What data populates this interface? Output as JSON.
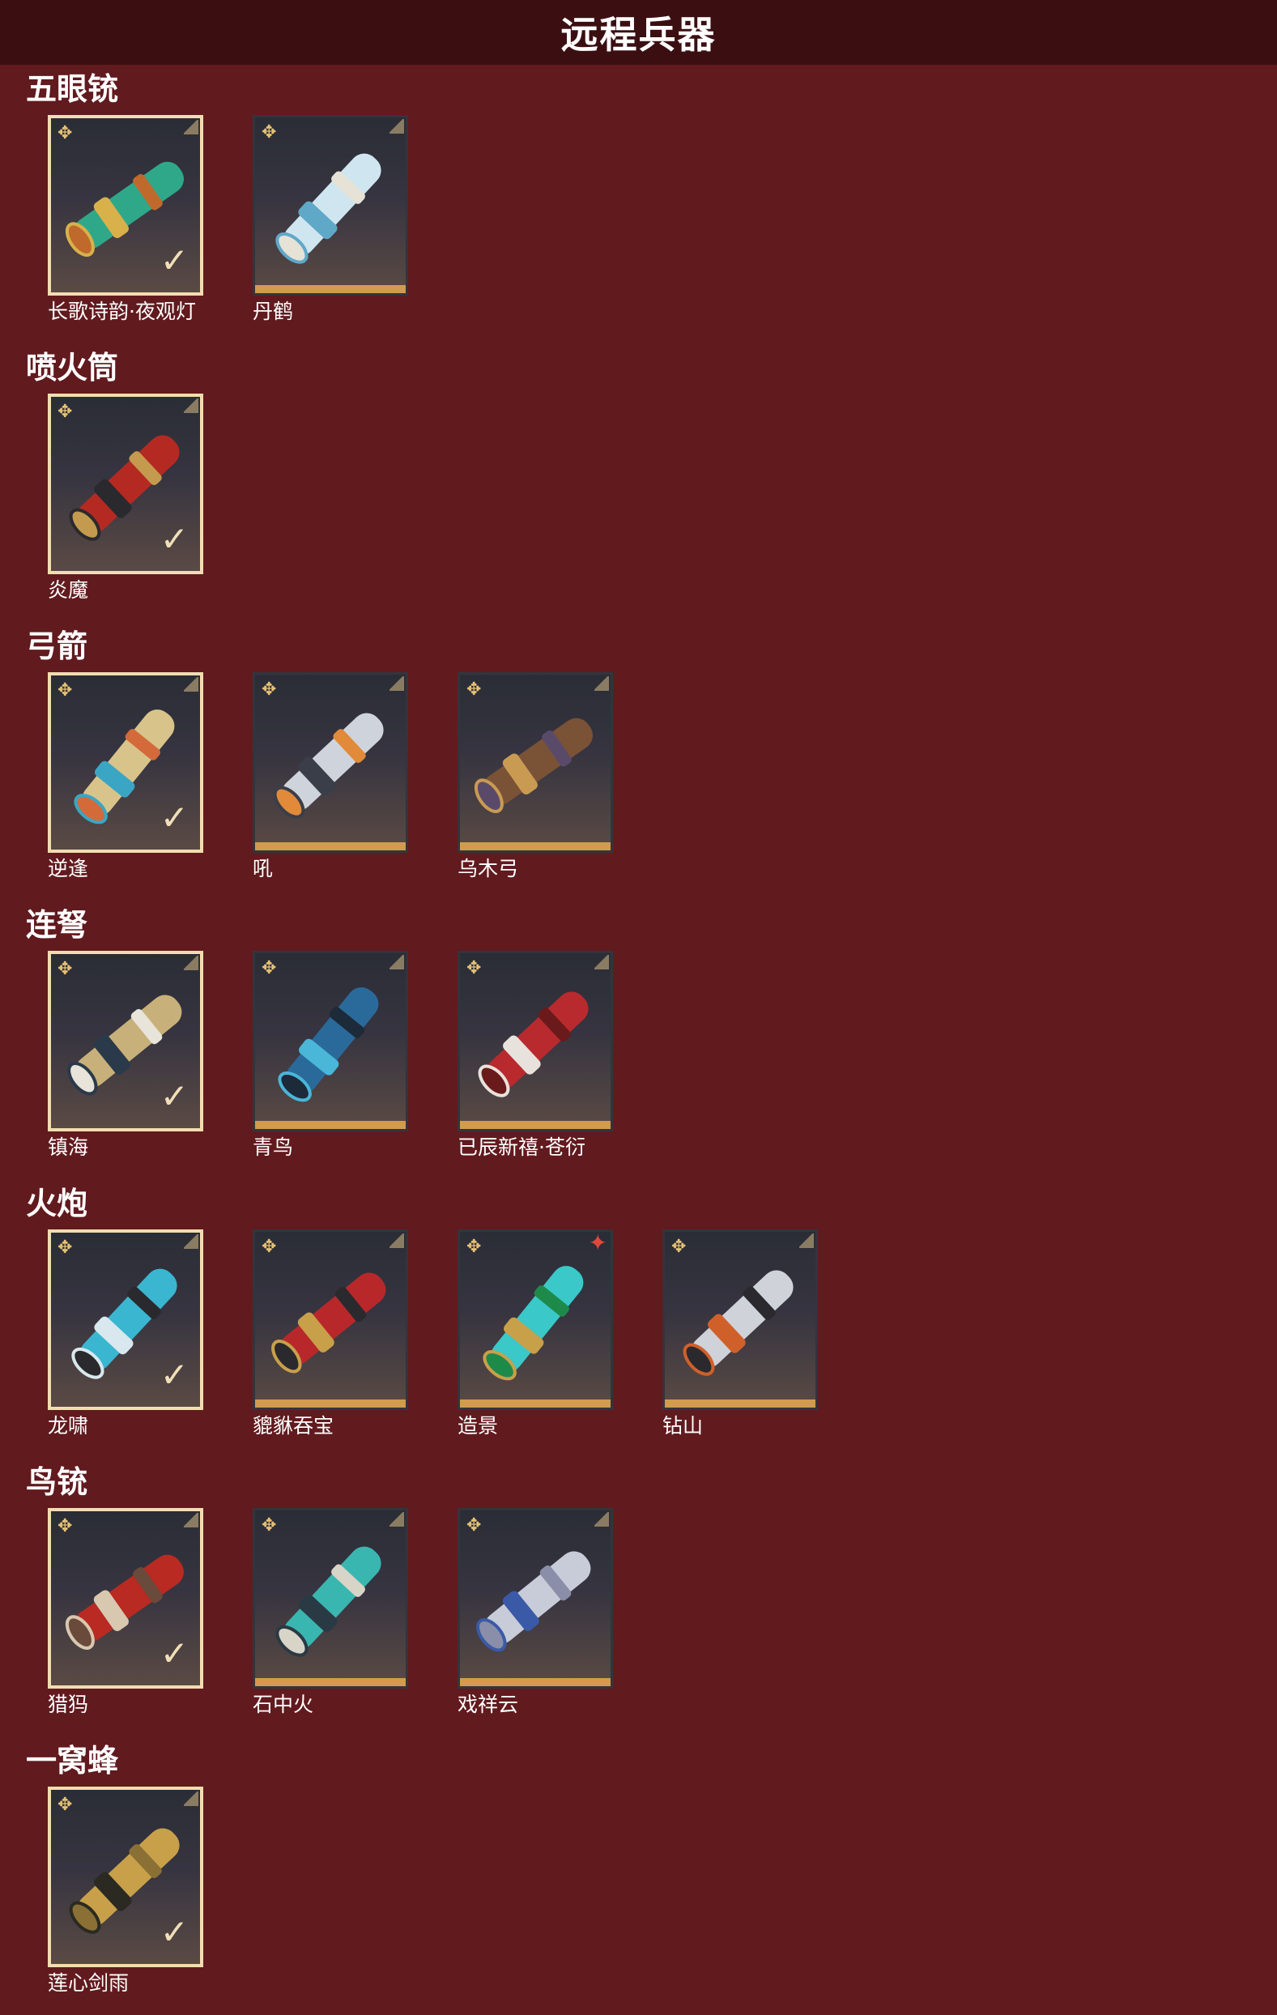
{
  "page": {
    "title": "远程兵器"
  },
  "sections": [
    {
      "title": "五眼铳",
      "items": [
        {
          "name": "长歌诗韵·夜观灯",
          "owned": true,
          "palette": [
            "#2fa88a",
            "#d8b14a",
            "#c0692c"
          ]
        },
        {
          "name": "丹鹤",
          "owned": false,
          "palette": [
            "#cfe6f0",
            "#5fa8c8",
            "#e6e2d6"
          ]
        }
      ]
    },
    {
      "title": "喷火筒",
      "items": [
        {
          "name": "炎魔",
          "owned": true,
          "palette": [
            "#b42a22",
            "#2a2a2e",
            "#c49a4e"
          ]
        }
      ]
    },
    {
      "title": "弓箭",
      "items": [
        {
          "name": "逆逢",
          "owned": true,
          "palette": [
            "#d8c48a",
            "#3aa6c4",
            "#d46a3a"
          ]
        },
        {
          "name": "吼",
          "owned": false,
          "palette": [
            "#cfd4dc",
            "#3a3e48",
            "#e08a3a"
          ]
        },
        {
          "name": "乌木弓",
          "owned": false,
          "palette": [
            "#7a5236",
            "#c99a52",
            "#5a4a6a"
          ]
        }
      ]
    },
    {
      "title": "连弩",
      "items": [
        {
          "name": "镇海",
          "owned": true,
          "palette": [
            "#c8b07a",
            "#2a3a4a",
            "#e8e4da"
          ]
        },
        {
          "name": "青鸟",
          "owned": false,
          "palette": [
            "#2a6a9a",
            "#4ab6d8",
            "#1c2a3a"
          ]
        },
        {
          "name": "已辰新禧·苍衍",
          "owned": false,
          "palette": [
            "#b82a2e",
            "#e8e2dc",
            "#6a1a1a"
          ]
        }
      ]
    },
    {
      "title": "火炮",
      "items": [
        {
          "name": "龙啸",
          "owned": true,
          "palette": [
            "#3ab6d0",
            "#d8e8ee",
            "#2a2a2e"
          ]
        },
        {
          "name": "貔貅吞宝",
          "owned": false,
          "palette": [
            "#b8282a",
            "#c8a04a",
            "#2a2a2e"
          ]
        },
        {
          "name": "造景",
          "owned": false,
          "rare": true,
          "palette": [
            "#3ac8c8",
            "#c8a04a",
            "#1e8a4a"
          ]
        },
        {
          "name": "钻山",
          "owned": false,
          "palette": [
            "#cfd2d8",
            "#d0602a",
            "#2a2a2e"
          ]
        }
      ]
    },
    {
      "title": "鸟铳",
      "items": [
        {
          "name": "猎犸",
          "owned": true,
          "palette": [
            "#b82a22",
            "#d8c8b0",
            "#6a4a3a"
          ]
        },
        {
          "name": "石中火",
          "owned": false,
          "palette": [
            "#3ab6b0",
            "#2a3a44",
            "#d8d4c8"
          ]
        },
        {
          "name": "戏祥云",
          "owned": false,
          "palette": [
            "#c8ccd8",
            "#3a5aa8",
            "#8a8ea8"
          ]
        }
      ]
    },
    {
      "title": "一窝蜂",
      "items": [
        {
          "name": "莲心剑雨",
          "owned": true,
          "palette": [
            "#c8a04a",
            "#2a2a22",
            "#8a7034"
          ]
        }
      ]
    }
  ],
  "icons": {
    "badge": "rank-badge-icon",
    "check": "owned-check-icon",
    "rare": "rare-star-icon"
  }
}
